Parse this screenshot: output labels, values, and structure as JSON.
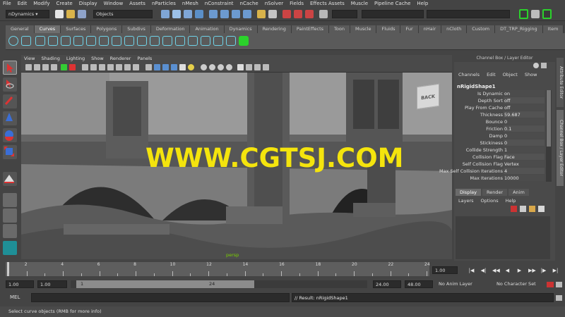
{
  "menubar": [
    "File",
    "Edit",
    "Modify",
    "Create",
    "Display",
    "Window",
    "Assets",
    "nParticles",
    "nMesh",
    "nConstraint",
    "nCache",
    "nSolver",
    "Fields",
    "Effects Assets",
    "Muscle",
    "Pipeline Cache",
    "Help"
  ],
  "statusline": {
    "menuset": "nDynamics",
    "selection_mode": "Objects"
  },
  "shelf_tabs": [
    "General",
    "Curves",
    "Surfaces",
    "Polygons",
    "Subdivs",
    "Deformation",
    "Animation",
    "Dynamics",
    "Rendering",
    "PaintEffects",
    "Toon",
    "Muscle",
    "Fluids",
    "Fur",
    "nHair",
    "nCloth",
    "Custom",
    "DT_TRP_Rigging",
    "Item"
  ],
  "shelf_active": "Curves",
  "viewport": {
    "menu": [
      "View",
      "Shading",
      "Lighting",
      "Show",
      "Renderer",
      "Panels"
    ],
    "camera_label": "persp",
    "viewcube_label": "BACK",
    "watermark": "WWW.CGTSJ.COM"
  },
  "channel_box": {
    "title": "Channel Box / Layer Editor",
    "menu": [
      "Channels",
      "Edit",
      "Object",
      "Show"
    ],
    "node": "nRigidShape1",
    "attributes": [
      {
        "name": "Is Dynamic",
        "value": "on"
      },
      {
        "name": "Depth Sort",
        "value": "off"
      },
      {
        "name": "Play From Cache",
        "value": "off"
      },
      {
        "name": "Thickness",
        "value": "59.687"
      },
      {
        "name": "Bounce",
        "value": "0"
      },
      {
        "name": "Friction",
        "value": "0.1"
      },
      {
        "name": "Damp",
        "value": "0"
      },
      {
        "name": "Stickiness",
        "value": "0"
      },
      {
        "name": "Collide Strength",
        "value": "1"
      },
      {
        "name": "Collision Flag",
        "value": "Face"
      },
      {
        "name": "Self Collision Flag",
        "value": "Vertex"
      },
      {
        "name": "Max Self Collision Iterations",
        "value": "4"
      },
      {
        "name": "Max Iterations",
        "value": "10000"
      }
    ],
    "layer_tabs": [
      "Display",
      "Render",
      "Anim"
    ],
    "layer_menu": [
      "Layers",
      "Options",
      "Help"
    ]
  },
  "side_tabs": [
    "Attribute Editor",
    "Channel Box / Layer Editor"
  ],
  "time_slider": {
    "ticks": [
      2,
      4,
      6,
      8,
      10,
      12,
      14,
      16,
      18,
      20,
      22,
      24
    ],
    "start": 1,
    "end": 24,
    "current_frame": "1.00"
  },
  "range_slider": {
    "start_time": "1.00",
    "playback_start": "1.00",
    "range_start_label": "1",
    "range_end_label": "24",
    "playback_end": "24.00",
    "end_time": "48.00",
    "anim_layer": "No Anim Layer",
    "character_set": "No Character Set"
  },
  "command_line": {
    "label": "MEL",
    "result": "// Result: nRigidShape1"
  },
  "help_line": "Select curve objects (RMB for more info)",
  "colors": {
    "watermark": "#f4e40d",
    "accent_teal": "#3fc0b8",
    "highlight_green": "#2bd22b"
  }
}
